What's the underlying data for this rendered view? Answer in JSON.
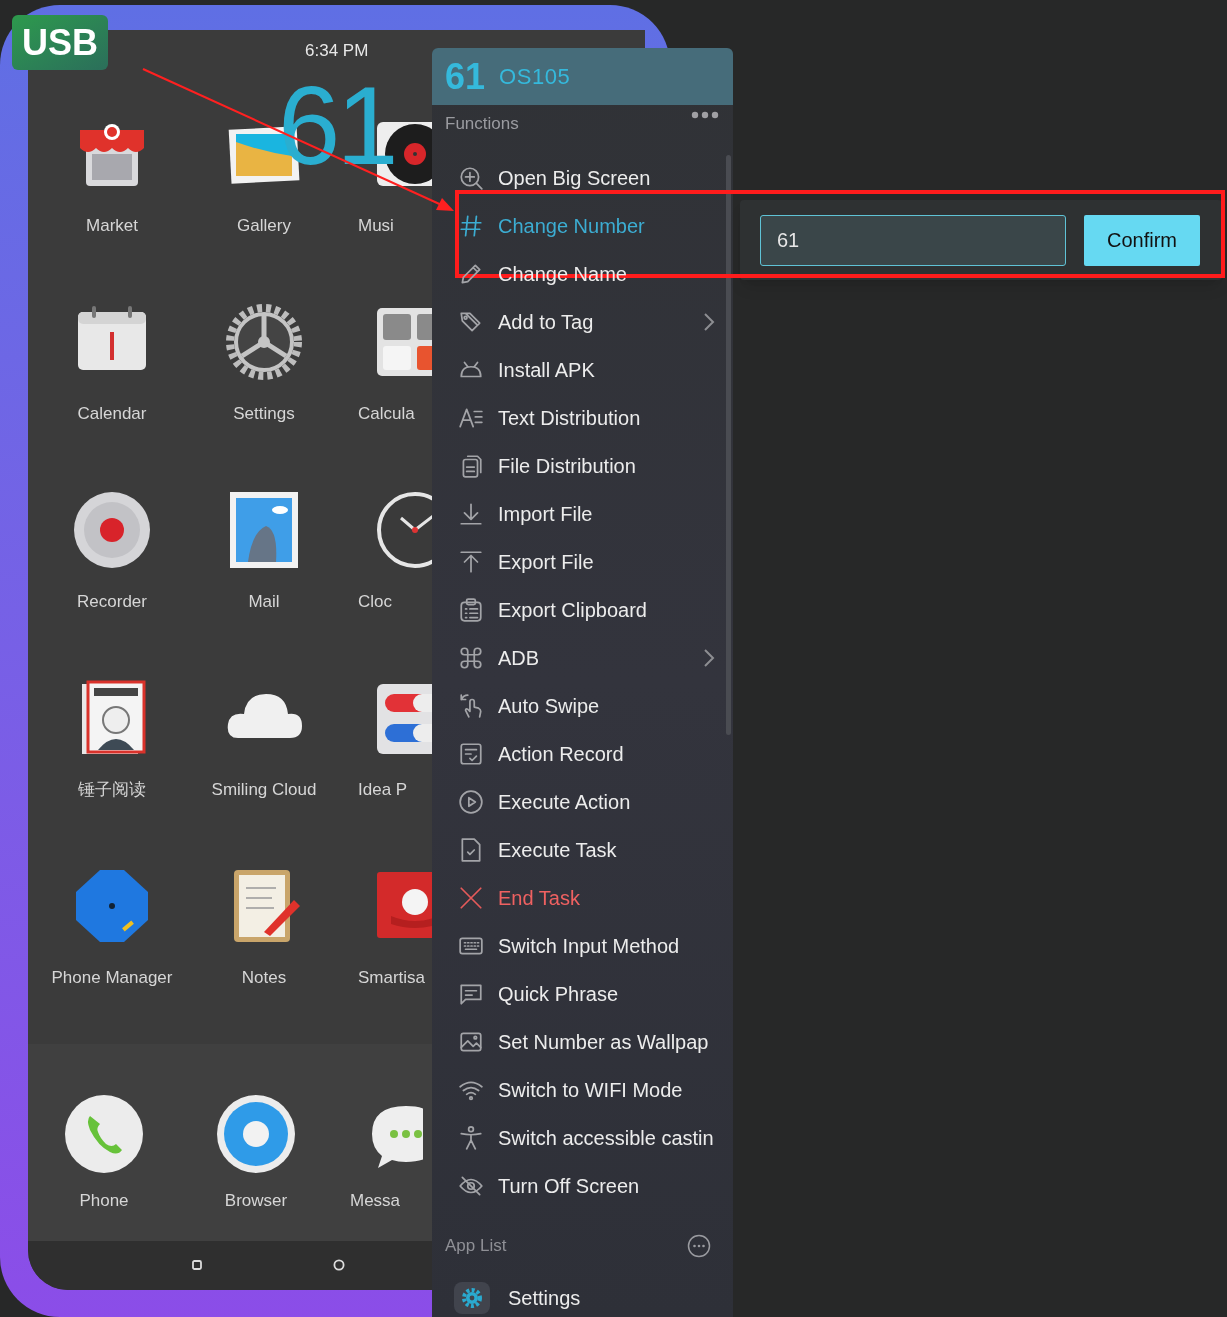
{
  "device": {
    "badge": "USB",
    "status_time": "6:34 PM",
    "wallpaper_number": "61",
    "apps": [
      {
        "label": "Market"
      },
      {
        "label": "Gallery"
      },
      {
        "label": "Musi"
      },
      {
        "label": "Calendar"
      },
      {
        "label": "Settings"
      },
      {
        "label": "Calcula"
      },
      {
        "label": "Recorder"
      },
      {
        "label": "Mail"
      },
      {
        "label": "Cloc"
      },
      {
        "label": "锤子阅读"
      },
      {
        "label": "Smiling Cloud"
      },
      {
        "label": "Idea P"
      },
      {
        "label": "Phone Manager"
      },
      {
        "label": "Notes"
      },
      {
        "label": "Smartisa"
      }
    ],
    "dock": [
      {
        "label": "Phone"
      },
      {
        "label": "Browser"
      },
      {
        "label": "Messa"
      }
    ]
  },
  "menu": {
    "number": "61",
    "device_name": "OS105",
    "functions_label": "Functions",
    "items": [
      {
        "label": "Open Big Screen",
        "selected": false,
        "kind": "action",
        "submenu": false
      },
      {
        "label": "Change Number",
        "selected": true,
        "kind": "action",
        "submenu": false
      },
      {
        "label": "Change Name",
        "selected": false,
        "kind": "action",
        "submenu": false
      },
      {
        "label": "Add to Tag",
        "selected": false,
        "kind": "action",
        "submenu": true
      },
      {
        "label": "Install APK",
        "selected": false,
        "kind": "action",
        "submenu": false
      },
      {
        "label": "Text Distribution",
        "selected": false,
        "kind": "action",
        "submenu": false
      },
      {
        "label": "File Distribution",
        "selected": false,
        "kind": "action",
        "submenu": false
      },
      {
        "label": "Import File",
        "selected": false,
        "kind": "action",
        "submenu": false
      },
      {
        "label": "Export File",
        "selected": false,
        "kind": "action",
        "submenu": false
      },
      {
        "label": "Export Clipboard",
        "selected": false,
        "kind": "action",
        "submenu": false
      },
      {
        "label": "ADB",
        "selected": false,
        "kind": "action",
        "submenu": true
      },
      {
        "label": "Auto Swipe",
        "selected": false,
        "kind": "action",
        "submenu": false
      },
      {
        "label": "Action Record",
        "selected": false,
        "kind": "action",
        "submenu": false
      },
      {
        "label": "Execute Action",
        "selected": false,
        "kind": "action",
        "submenu": false
      },
      {
        "label": "Execute Task",
        "selected": false,
        "kind": "action",
        "submenu": false
      },
      {
        "label": "End Task",
        "selected": false,
        "kind": "danger",
        "submenu": false
      },
      {
        "label": "Switch Input Method",
        "selected": false,
        "kind": "action",
        "submenu": false
      },
      {
        "label": "Quick Phrase",
        "selected": false,
        "kind": "action",
        "submenu": false
      },
      {
        "label": "Set Number as Wallpap",
        "selected": false,
        "kind": "action",
        "submenu": false
      },
      {
        "label": "Switch to WIFI Mode",
        "selected": false,
        "kind": "action",
        "submenu": false
      },
      {
        "label": "Switch accessible castin",
        "selected": false,
        "kind": "action",
        "submenu": false
      },
      {
        "label": "Turn Off Screen",
        "selected": false,
        "kind": "action",
        "submenu": false
      }
    ],
    "app_list_label": "App List",
    "apps": [
      {
        "label": "Settings"
      }
    ]
  },
  "change_number_popup": {
    "value": "61",
    "button": "Confirm"
  }
}
